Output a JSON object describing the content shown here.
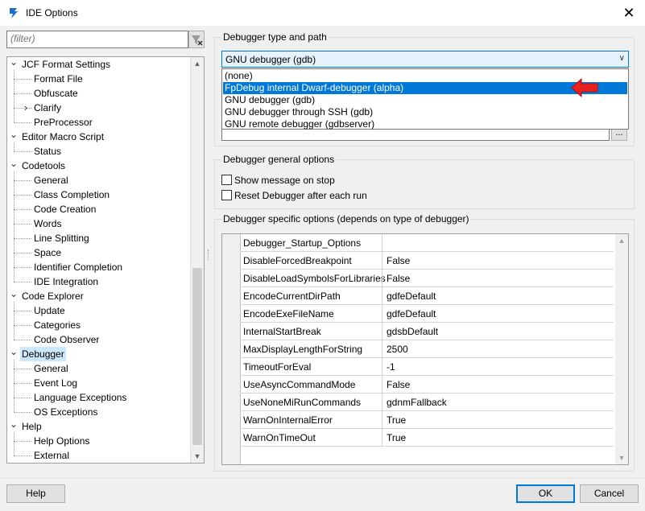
{
  "window": {
    "title": "IDE Options",
    "close_glyph": "✕",
    "icon": "lazarus-icon"
  },
  "filter": {
    "placeholder": "(filter)",
    "value": ""
  },
  "tree": {
    "items": [
      {
        "label": "JCF Format Settings",
        "level": 0,
        "expander": "collapse"
      },
      {
        "label": "Format File",
        "level": 1
      },
      {
        "label": "Obfuscate",
        "level": 1
      },
      {
        "label": "Clarify",
        "level": 1,
        "expander": "expand"
      },
      {
        "label": "PreProcessor",
        "level": 1
      },
      {
        "label": "Editor Macro Script",
        "level": 0,
        "expander": "collapse"
      },
      {
        "label": "Status",
        "level": 1
      },
      {
        "label": "Codetools",
        "level": 0,
        "expander": "collapse"
      },
      {
        "label": "General",
        "level": 1
      },
      {
        "label": "Class Completion",
        "level": 1
      },
      {
        "label": "Code Creation",
        "level": 1
      },
      {
        "label": "Words",
        "level": 1
      },
      {
        "label": "Line Splitting",
        "level": 1
      },
      {
        "label": "Space",
        "level": 1
      },
      {
        "label": "Identifier Completion",
        "level": 1
      },
      {
        "label": "IDE Integration",
        "level": 1
      },
      {
        "label": "Code Explorer",
        "level": 0,
        "expander": "collapse"
      },
      {
        "label": "Update",
        "level": 1
      },
      {
        "label": "Categories",
        "level": 1
      },
      {
        "label": "Code Observer",
        "level": 1
      },
      {
        "label": "Debugger",
        "level": 0,
        "expander": "collapse",
        "selected": true
      },
      {
        "label": "General",
        "level": 1
      },
      {
        "label": "Event Log",
        "level": 1
      },
      {
        "label": "Language Exceptions",
        "level": 1
      },
      {
        "label": "OS Exceptions",
        "level": 1
      },
      {
        "label": "Help",
        "level": 0,
        "expander": "collapse"
      },
      {
        "label": "Help Options",
        "level": 1
      },
      {
        "label": "External",
        "level": 1
      }
    ]
  },
  "debugger_type": {
    "group_label": "Debugger type and path",
    "selected": "GNU debugger (gdb)",
    "options": [
      "(none)",
      "FpDebug internal Dwarf-debugger (alpha)",
      "GNU debugger (gdb)",
      "GNU debugger through SSH (gdb)",
      "GNU remote debugger (gdbserver)"
    ],
    "highlighted_index": 1,
    "path_button": "..."
  },
  "general_options": {
    "group_label": "Debugger general options",
    "show_message_on_stop": {
      "label": "Show message on stop",
      "checked": false
    },
    "reset_after_run": {
      "label": "Reset Debugger after each run",
      "checked": false
    }
  },
  "specific_options": {
    "group_label": "Debugger specific options (depends on type of debugger)",
    "rows": [
      {
        "key": "Debugger_Startup_Options",
        "value": ""
      },
      {
        "key": "DisableForcedBreakpoint",
        "value": "False"
      },
      {
        "key": "DisableLoadSymbolsForLibraries",
        "value": "False"
      },
      {
        "key": "EncodeCurrentDirPath",
        "value": "gdfeDefault"
      },
      {
        "key": "EncodeExeFileName",
        "value": "gdfeDefault"
      },
      {
        "key": "InternalStartBreak",
        "value": "gdsbDefault"
      },
      {
        "key": "MaxDisplayLengthForString",
        "value": "2500"
      },
      {
        "key": "TimeoutForEval",
        "value": "-1"
      },
      {
        "key": "UseAsyncCommandMode",
        "value": "False"
      },
      {
        "key": "UseNoneMiRunCommands",
        "value": "gdnmFallback"
      },
      {
        "key": "WarnOnInternalError",
        "value": "True"
      },
      {
        "key": "WarnOnTimeOut",
        "value": "True"
      }
    ]
  },
  "buttons": {
    "help": "Help",
    "ok": "OK",
    "cancel": "Cancel"
  },
  "colors": {
    "accent": "#0078d7",
    "arrow": "#e8201e",
    "selection": "#cce8ff"
  }
}
